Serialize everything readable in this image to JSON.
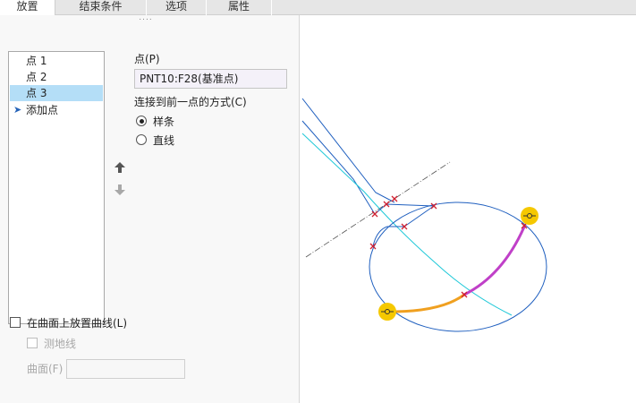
{
  "tabs": [
    "放置",
    "结束条件",
    "选项",
    "属性"
  ],
  "panel": {
    "grip": "....",
    "points": [
      "点 1",
      "点 2",
      "点 3"
    ],
    "add_point": "添加点",
    "point_label": "点(P)",
    "point_value": "PNT10:F28(基准点)",
    "connect_label": "连接到前一点的方式(C)",
    "connect_options": [
      "样条",
      "直线"
    ],
    "place_on_surface": "在曲面上放置曲线(L)",
    "geodesic": "测地线",
    "surface_label": "曲面(F)",
    "surface_value": ""
  },
  "toolbar": {
    "icons": [
      "zoom-to-fit-icon",
      "zoom-in-icon",
      "zoom-out-icon",
      "refit-icon",
      "shading-icon",
      "saved-views-icon",
      "view-manager-icon",
      "perspective-icon",
      "annotation-display-icon",
      "axis-display-icon",
      "point-display-icon",
      "csys-display-icon",
      "spin-center-icon"
    ]
  },
  "colors": {
    "accent_blue": "#2563b8",
    "selection_bg": "#b4def7",
    "curve_blue": "#1f5fbf",
    "curve_cyan": "#1ec8d8",
    "curve_magenta": "#c040c8",
    "curve_orange": "#f0a020",
    "handle_yellow": "#f5c800"
  }
}
